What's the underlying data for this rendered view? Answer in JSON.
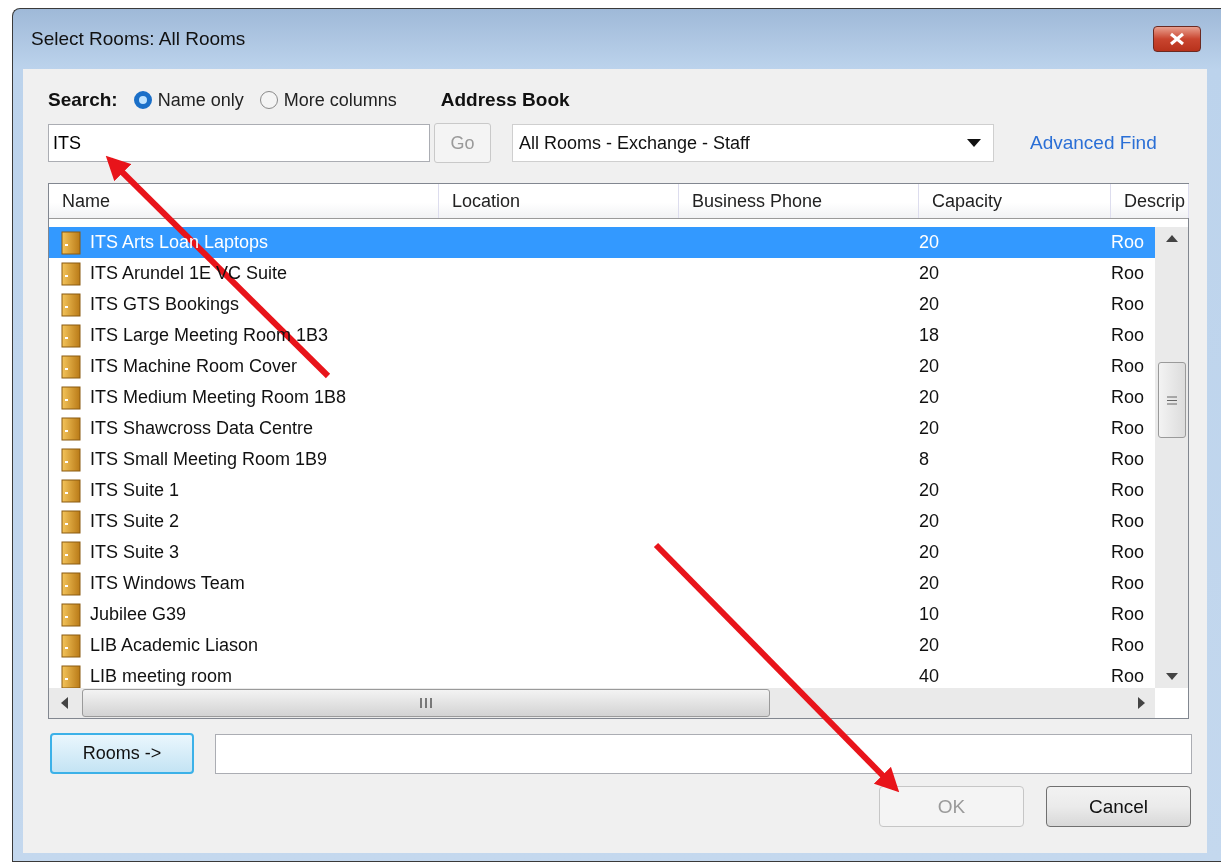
{
  "window": {
    "title": "Select Rooms: All Rooms"
  },
  "search": {
    "label": "Search:",
    "options": [
      {
        "label": "Name only",
        "selected": true
      },
      {
        "label": "More columns",
        "selected": false
      }
    ],
    "value": "ITS",
    "go": "Go"
  },
  "address_book": {
    "label": "Address Book",
    "value": "All Rooms - Exchange - Staff",
    "advanced_find": "Advanced Find"
  },
  "table": {
    "columns": [
      "Name",
      "Location",
      "Business Phone",
      "Capacity",
      "Descrip"
    ],
    "rows": [
      {
        "name": "ITS Arts Loan Laptops",
        "capacity": "20",
        "description": "Roo",
        "selected": true
      },
      {
        "name": "ITS Arundel 1E VC Suite",
        "capacity": "20",
        "description": "Roo",
        "selected": false
      },
      {
        "name": "ITS GTS Bookings",
        "capacity": "20",
        "description": "Roo",
        "selected": false
      },
      {
        "name": "ITS Large Meeting Room 1B3",
        "capacity": "18",
        "description": "Roo",
        "selected": false
      },
      {
        "name": "ITS Machine Room Cover",
        "capacity": "20",
        "description": "Roo",
        "selected": false
      },
      {
        "name": "ITS Medium Meeting Room 1B8",
        "capacity": "20",
        "description": "Roo",
        "selected": false
      },
      {
        "name": "ITS Shawcross Data Centre",
        "capacity": "20",
        "description": "Roo",
        "selected": false
      },
      {
        "name": "ITS Small Meeting Room 1B9",
        "capacity": "8",
        "description": "Roo",
        "selected": false
      },
      {
        "name": "ITS Suite 1",
        "capacity": "20",
        "description": "Roo",
        "selected": false
      },
      {
        "name": "ITS Suite 2",
        "capacity": "20",
        "description": "Roo",
        "selected": false
      },
      {
        "name": "ITS Suite 3",
        "capacity": "20",
        "description": "Roo",
        "selected": false
      },
      {
        "name": "ITS Windows Team",
        "capacity": "20",
        "description": "Roo",
        "selected": false
      },
      {
        "name": "Jubilee G39",
        "capacity": "10",
        "description": "Roo",
        "selected": false
      },
      {
        "name": "LIB Academic Liason",
        "capacity": "20",
        "description": "Roo",
        "selected": false
      },
      {
        "name": "LIB meeting room",
        "capacity": "40",
        "description": "Roo",
        "selected": false
      }
    ]
  },
  "rooms_button": "Rooms ->",
  "buttons": [
    {
      "label": "OK",
      "disabled": true
    },
    {
      "label": "Cancel",
      "disabled": false
    }
  ]
}
